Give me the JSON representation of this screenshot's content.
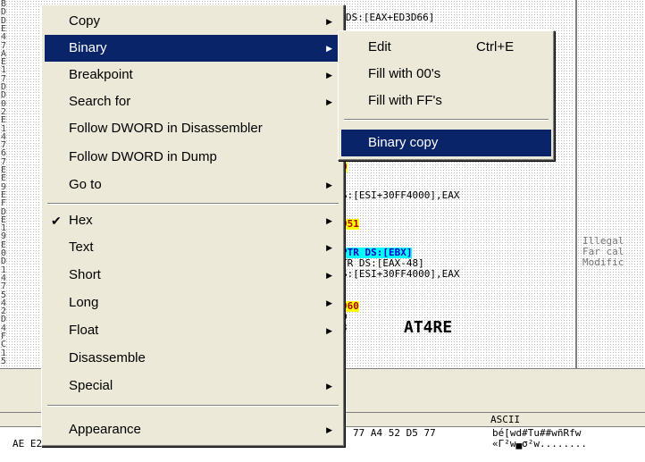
{
  "disasm": {
    "address_chars": [
      "B",
      "D",
      "D",
      "E",
      "4",
      "7",
      "A",
      "E",
      "1",
      "7",
      "D",
      "D",
      "0",
      "2",
      "E",
      "1",
      "4",
      "7",
      "6",
      "7",
      "E",
      "E",
      "9",
      "E",
      "F",
      "D",
      "E",
      "1",
      "9",
      "E",
      "0",
      "D",
      "1",
      "4",
      "7",
      "5",
      "4",
      "2",
      "D",
      "4",
      "F",
      "C",
      "1",
      "5"
    ],
    "lines": [
      {
        "id": "l1",
        "text": "DS:[EAX+ED3D66]",
        "hl": ""
      },
      {
        "id": "l2",
        "text": "0",
        "hl": "yellow"
      },
      {
        "id": "l3",
        "text": "S:[ESI+30FF4000],EAX",
        "hl": ""
      },
      {
        "id": "l4",
        "text": "951",
        "hl": "yellow"
      },
      {
        "id": "l5",
        "text": "PTR DS:[EBX]",
        "hl": "cyan"
      },
      {
        "id": "l6",
        "text": "TR DS:[EAX-48]",
        "hl": ""
      },
      {
        "id": "l7",
        "text": "S:[ESI+30FF4000],EAX",
        "hl": ""
      },
      {
        "id": "l8",
        "text": "960",
        "hl": "yellow"
      },
      {
        "id": "l9",
        "text": "0",
        "hl": ""
      },
      {
        "id": "l10",
        "text": "3",
        "hl": ""
      }
    ],
    "comments": [
      "Illegal",
      "Far cal",
      "Modific"
    ]
  },
  "watermark": "AT4RE",
  "dump": {
    "ascii_header": "ASCII",
    "rows": [
      {
        "hex": "77 A4 52 D5 77",
        "ascii": "bé[wd#Tu##wñRfw"
      },
      {
        "hex": "AE E2 D4 77 DC E5 D4 77 00 00 00 00 00 00 00 00",
        "ascii": "«Γ²w▄σ²w........"
      }
    ]
  },
  "context_menu": {
    "items": [
      {
        "id": "copy",
        "label": "Copy",
        "submenu": true
      },
      {
        "id": "binary",
        "label": "Binary",
        "submenu": true,
        "highlighted": true
      },
      {
        "id": "breakpoint",
        "label": "Breakpoint",
        "submenu": true
      },
      {
        "id": "search-for",
        "label": "Search for",
        "submenu": true
      },
      {
        "id": "follow-dword-disasm",
        "label": "Follow DWORD in Disassembler",
        "submenu": false
      },
      {
        "id": "follow-dword-dump",
        "label": "Follow DWORD in Dump",
        "submenu": false
      },
      {
        "id": "go-to",
        "label": "Go to",
        "submenu": true
      },
      {
        "id": "hex",
        "label": "Hex",
        "submenu": true,
        "checked": true
      },
      {
        "id": "text",
        "label": "Text",
        "submenu": true
      },
      {
        "id": "short",
        "label": "Short",
        "submenu": true
      },
      {
        "id": "long",
        "label": "Long",
        "submenu": true
      },
      {
        "id": "float",
        "label": "Float",
        "submenu": true
      },
      {
        "id": "disassemble",
        "label": "Disassemble",
        "submenu": false
      },
      {
        "id": "special",
        "label": "Special",
        "submenu": true
      },
      {
        "id": "appearance",
        "label": "Appearance",
        "submenu": true
      }
    ]
  },
  "binary_submenu": {
    "items": [
      {
        "id": "edit",
        "label": "Edit",
        "shortcut": "Ctrl+E"
      },
      {
        "id": "fill-00",
        "label": "Fill with 00's",
        "shortcut": ""
      },
      {
        "id": "fill-ff",
        "label": "Fill with FF's",
        "shortcut": ""
      },
      {
        "id": "binary-copy",
        "label": "Binary copy",
        "shortcut": "",
        "highlighted": true
      }
    ]
  },
  "colors": {
    "menu_bg": "#ece9d8",
    "menu_highlight": "#0a246a",
    "code_yellow": "#ffff00",
    "code_cyan": "#00ffff"
  }
}
